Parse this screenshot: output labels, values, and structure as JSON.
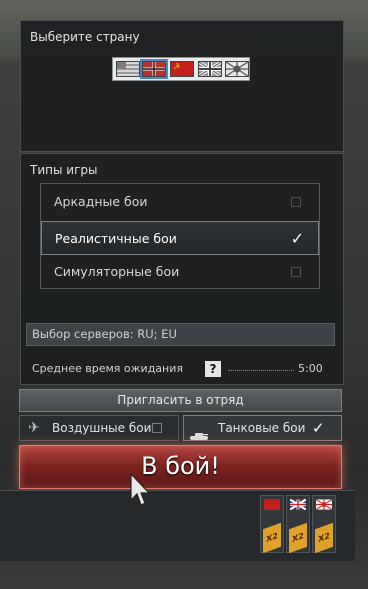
{
  "country": {
    "title": "Выберите страну",
    "flags": [
      {
        "name": "usa-flag",
        "selected": false
      },
      {
        "name": "germany-flag",
        "selected": true
      },
      {
        "name": "ussr-flag",
        "selected": false
      },
      {
        "name": "britain-flag",
        "selected": false
      },
      {
        "name": "japan-flag",
        "selected": false
      }
    ]
  },
  "game_modes": {
    "title": "Типы игры",
    "items": [
      {
        "label": "Аркадные бои",
        "selected": false
      },
      {
        "label": "Реалистичные бои",
        "selected": true
      },
      {
        "label": "Симуляторные бои",
        "selected": false
      }
    ]
  },
  "servers": {
    "label": "Выбор серверов: RU; EU"
  },
  "wait": {
    "label": "Среднее время ожидания",
    "help": "?",
    "time": "5:00"
  },
  "invite": {
    "label": "Пригласить в отряд"
  },
  "modes": {
    "air_label": "Воздушные бои",
    "tank_label": "Танковые бои",
    "tank_check": "✓"
  },
  "battle": {
    "label": "В бой!"
  },
  "rank_cards": [
    {
      "nation": "ussr",
      "badge": "X2"
    },
    {
      "nation": "britain",
      "badge": "X2"
    },
    {
      "nation": "japan",
      "badge": "X2"
    }
  ],
  "colors": {
    "accent_blue": "#4a87c9",
    "battle_red": "#9e2f2a",
    "badge_orange": "#e0a12b"
  }
}
